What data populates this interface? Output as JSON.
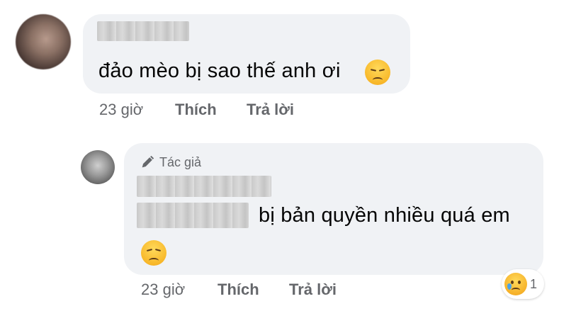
{
  "comment_1": {
    "author_name": "",
    "text": "đảo mèo bị sao thế anh ơi",
    "emoji": "pensive-face-icon",
    "time": "23 giờ",
    "like_label": "Thích",
    "reply_label": "Trả lời"
  },
  "comment_2": {
    "badge": "Tác giả",
    "badge_icon": "pencil-icon",
    "author_name": "",
    "mention": "",
    "text": "bị bản quyền nhiều quá em",
    "emoji": "disappointed-face-icon",
    "time": "23 giờ",
    "like_label": "Thích",
    "reply_label": "Trả lời",
    "reaction": {
      "icon": "sad-tear-face-icon",
      "count": "1"
    }
  },
  "colors": {
    "bubble": "#f0f2f5",
    "meta_text": "#65676b",
    "text": "#050505"
  }
}
